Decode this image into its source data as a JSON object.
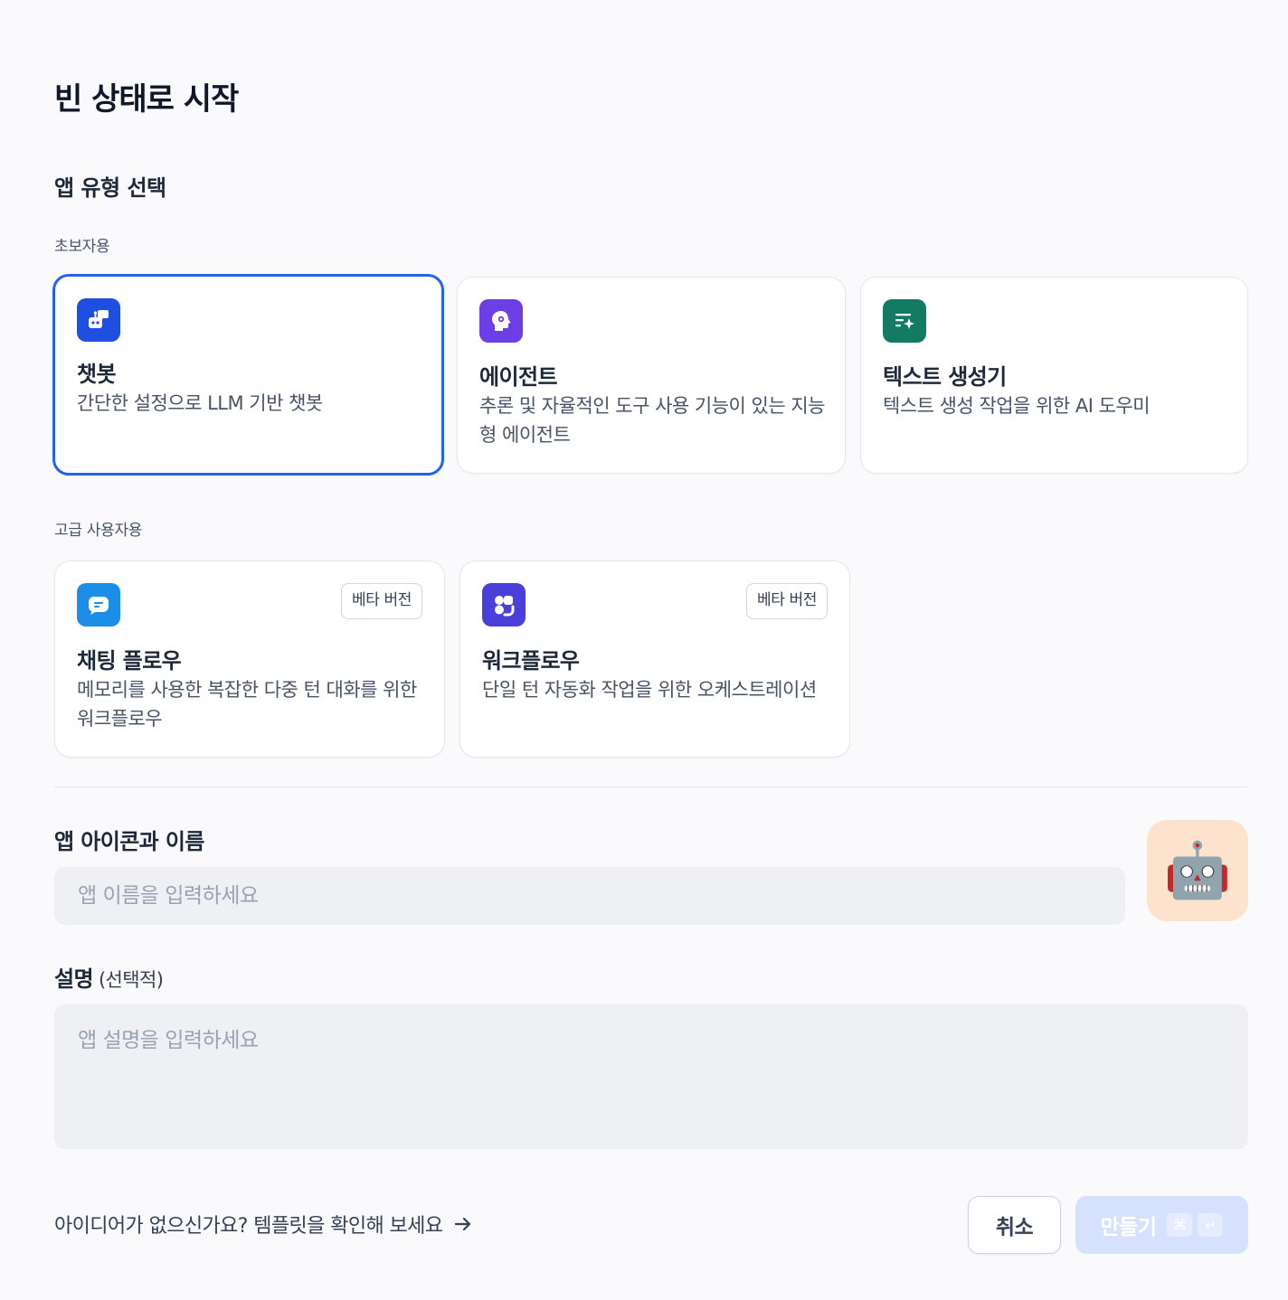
{
  "page": {
    "title": "빈 상태로 시작"
  },
  "app_type": {
    "title": "앱 유형 선택",
    "beginner": {
      "label": "초보자용",
      "cards": [
        {
          "name": "챗봇",
          "desc": "간단한 설정으로 LLM 기반 챗봇",
          "icon": "chatbot-icon",
          "color": "#1f4fe0",
          "selected": true
        },
        {
          "name": "에이전트",
          "desc": "추론 및 자율적인 도구 사용 기능이 있는 지능형 에이전트",
          "icon": "agent-icon",
          "color": "#6b3ee6"
        },
        {
          "name": "텍스트 생성기",
          "desc": "텍스트 생성 작업을 위한 AI 도우미",
          "icon": "text-generator-icon",
          "color": "#137a64"
        }
      ]
    },
    "advanced": {
      "label": "고급 사용자용",
      "cards": [
        {
          "name": "채팅 플로우",
          "desc": "메모리를 사용한 복잡한 다중 턴 대화를 위한 워크플로우",
          "badge": "베타 버전",
          "icon": "chatflow-icon",
          "color": "#1b8fe8"
        },
        {
          "name": "워크플로우",
          "desc": "단일 턴 자동화 작업을 위한 오케스트레이션",
          "badge": "베타 버전",
          "icon": "workflow-icon",
          "color": "#4b3fd9"
        }
      ]
    }
  },
  "form": {
    "name_label": "앱 아이콘과 이름",
    "name_placeholder": "앱 이름을 입력하세요",
    "avatar_emoji": "🤖",
    "desc_label": "설명",
    "desc_optional": "(선택적)",
    "desc_placeholder": "앱 설명을 입력하세요"
  },
  "footer": {
    "template_link": "아이디어가 없으신가요? 템플릿을 확인해 보세요",
    "cancel": "취소",
    "create": "만들기",
    "shortcut_cmd": "⌘",
    "shortcut_enter": "↵"
  }
}
